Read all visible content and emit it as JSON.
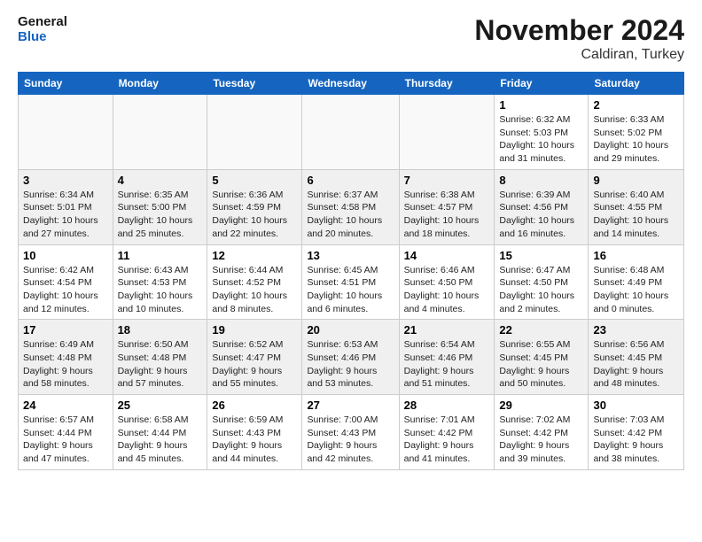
{
  "logo": {
    "line1": "General",
    "line2": "Blue"
  },
  "title": "November 2024",
  "location": "Caldiran, Turkey",
  "weekdays": [
    "Sunday",
    "Monday",
    "Tuesday",
    "Wednesday",
    "Thursday",
    "Friday",
    "Saturday"
  ],
  "weeks": [
    [
      {
        "day": "",
        "info": ""
      },
      {
        "day": "",
        "info": ""
      },
      {
        "day": "",
        "info": ""
      },
      {
        "day": "",
        "info": ""
      },
      {
        "day": "",
        "info": ""
      },
      {
        "day": "1",
        "info": "Sunrise: 6:32 AM\nSunset: 5:03 PM\nDaylight: 10 hours and 31 minutes."
      },
      {
        "day": "2",
        "info": "Sunrise: 6:33 AM\nSunset: 5:02 PM\nDaylight: 10 hours and 29 minutes."
      }
    ],
    [
      {
        "day": "3",
        "info": "Sunrise: 6:34 AM\nSunset: 5:01 PM\nDaylight: 10 hours and 27 minutes."
      },
      {
        "day": "4",
        "info": "Sunrise: 6:35 AM\nSunset: 5:00 PM\nDaylight: 10 hours and 25 minutes."
      },
      {
        "day": "5",
        "info": "Sunrise: 6:36 AM\nSunset: 4:59 PM\nDaylight: 10 hours and 22 minutes."
      },
      {
        "day": "6",
        "info": "Sunrise: 6:37 AM\nSunset: 4:58 PM\nDaylight: 10 hours and 20 minutes."
      },
      {
        "day": "7",
        "info": "Sunrise: 6:38 AM\nSunset: 4:57 PM\nDaylight: 10 hours and 18 minutes."
      },
      {
        "day": "8",
        "info": "Sunrise: 6:39 AM\nSunset: 4:56 PM\nDaylight: 10 hours and 16 minutes."
      },
      {
        "day": "9",
        "info": "Sunrise: 6:40 AM\nSunset: 4:55 PM\nDaylight: 10 hours and 14 minutes."
      }
    ],
    [
      {
        "day": "10",
        "info": "Sunrise: 6:42 AM\nSunset: 4:54 PM\nDaylight: 10 hours and 12 minutes."
      },
      {
        "day": "11",
        "info": "Sunrise: 6:43 AM\nSunset: 4:53 PM\nDaylight: 10 hours and 10 minutes."
      },
      {
        "day": "12",
        "info": "Sunrise: 6:44 AM\nSunset: 4:52 PM\nDaylight: 10 hours and 8 minutes."
      },
      {
        "day": "13",
        "info": "Sunrise: 6:45 AM\nSunset: 4:51 PM\nDaylight: 10 hours and 6 minutes."
      },
      {
        "day": "14",
        "info": "Sunrise: 6:46 AM\nSunset: 4:50 PM\nDaylight: 10 hours and 4 minutes."
      },
      {
        "day": "15",
        "info": "Sunrise: 6:47 AM\nSunset: 4:50 PM\nDaylight: 10 hours and 2 minutes."
      },
      {
        "day": "16",
        "info": "Sunrise: 6:48 AM\nSunset: 4:49 PM\nDaylight: 10 hours and 0 minutes."
      }
    ],
    [
      {
        "day": "17",
        "info": "Sunrise: 6:49 AM\nSunset: 4:48 PM\nDaylight: 9 hours and 58 minutes."
      },
      {
        "day": "18",
        "info": "Sunrise: 6:50 AM\nSunset: 4:48 PM\nDaylight: 9 hours and 57 minutes."
      },
      {
        "day": "19",
        "info": "Sunrise: 6:52 AM\nSunset: 4:47 PM\nDaylight: 9 hours and 55 minutes."
      },
      {
        "day": "20",
        "info": "Sunrise: 6:53 AM\nSunset: 4:46 PM\nDaylight: 9 hours and 53 minutes."
      },
      {
        "day": "21",
        "info": "Sunrise: 6:54 AM\nSunset: 4:46 PM\nDaylight: 9 hours and 51 minutes."
      },
      {
        "day": "22",
        "info": "Sunrise: 6:55 AM\nSunset: 4:45 PM\nDaylight: 9 hours and 50 minutes."
      },
      {
        "day": "23",
        "info": "Sunrise: 6:56 AM\nSunset: 4:45 PM\nDaylight: 9 hours and 48 minutes."
      }
    ],
    [
      {
        "day": "24",
        "info": "Sunrise: 6:57 AM\nSunset: 4:44 PM\nDaylight: 9 hours and 47 minutes."
      },
      {
        "day": "25",
        "info": "Sunrise: 6:58 AM\nSunset: 4:44 PM\nDaylight: 9 hours and 45 minutes."
      },
      {
        "day": "26",
        "info": "Sunrise: 6:59 AM\nSunset: 4:43 PM\nDaylight: 9 hours and 44 minutes."
      },
      {
        "day": "27",
        "info": "Sunrise: 7:00 AM\nSunset: 4:43 PM\nDaylight: 9 hours and 42 minutes."
      },
      {
        "day": "28",
        "info": "Sunrise: 7:01 AM\nSunset: 4:42 PM\nDaylight: 9 hours and 41 minutes."
      },
      {
        "day": "29",
        "info": "Sunrise: 7:02 AM\nSunset: 4:42 PM\nDaylight: 9 hours and 39 minutes."
      },
      {
        "day": "30",
        "info": "Sunrise: 7:03 AM\nSunset: 4:42 PM\nDaylight: 9 hours and 38 minutes."
      }
    ]
  ]
}
